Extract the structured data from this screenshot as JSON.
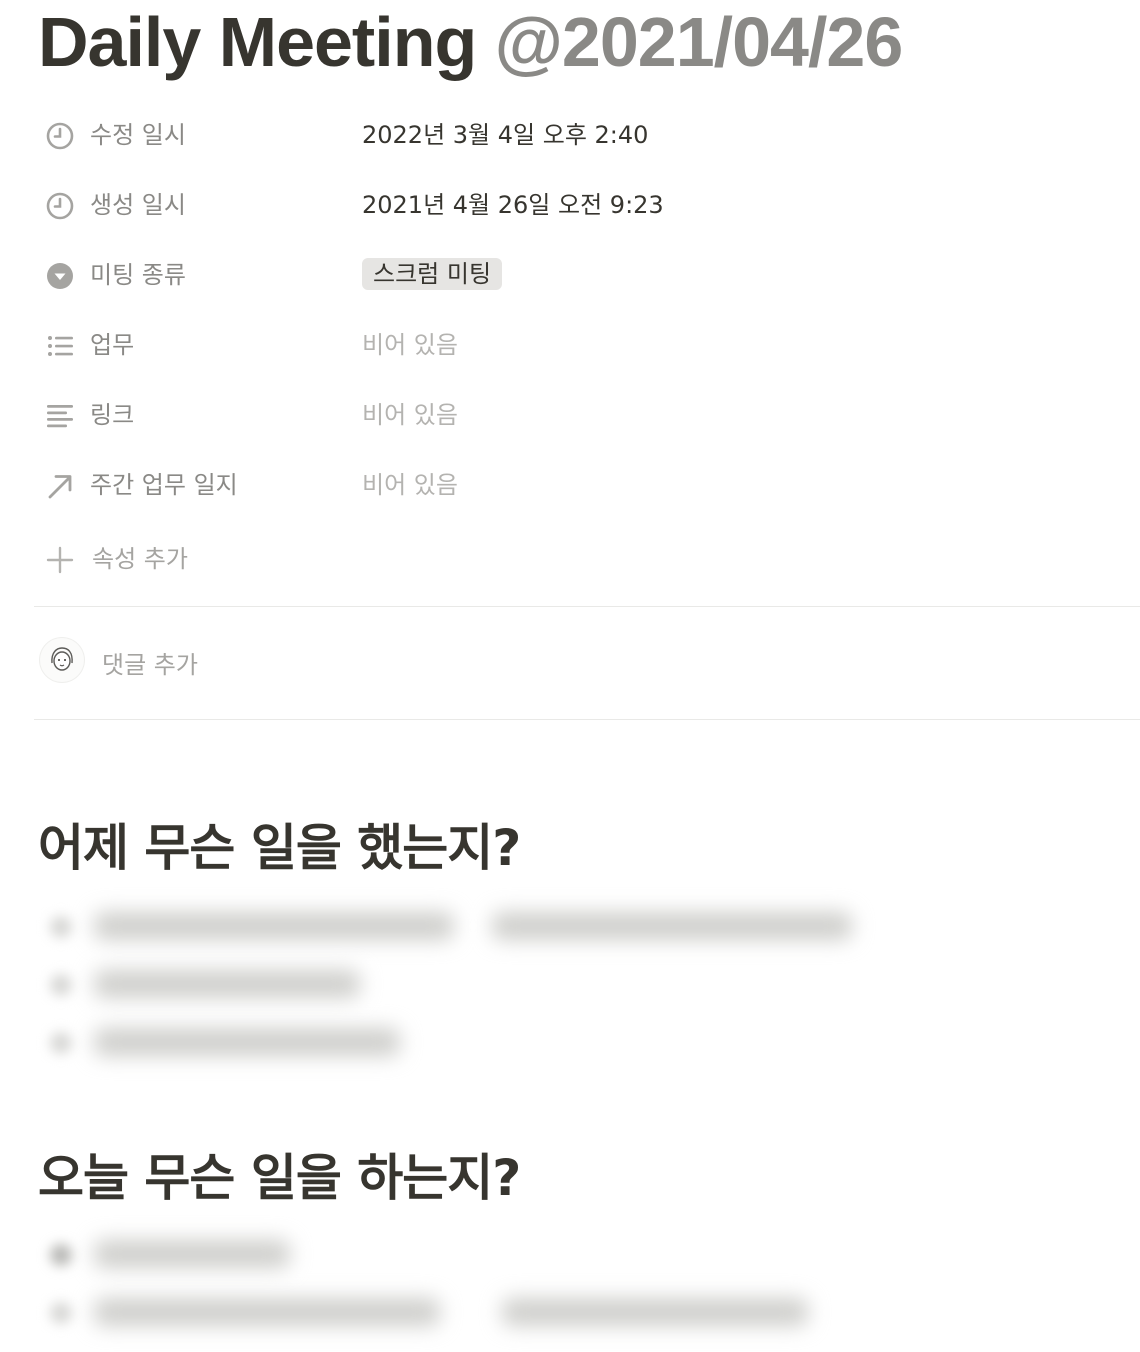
{
  "page": {
    "title": "Daily Meeting",
    "title_mention": "@2021/04/26"
  },
  "properties": [
    {
      "icon": "clock-icon",
      "label": "수정 일시",
      "value": "2022년 3월 4일 오후 2:40"
    },
    {
      "icon": "clock-icon",
      "label": "생성 일시",
      "value": "2021년 4월 26일 오전 9:23"
    },
    {
      "icon": "select-icon",
      "label": "미팅 종류",
      "value": "스크럼 미팅"
    },
    {
      "icon": "list-icon",
      "label": "업무",
      "value": "비어 있음"
    },
    {
      "icon": "text-icon",
      "label": "링크",
      "value": "비어 있음"
    },
    {
      "icon": "relation-arrow-icon",
      "label": "주간 업무 일지",
      "value": "비어 있음"
    }
  ],
  "add_property_label": "속성 추가",
  "comment": {
    "placeholder": "댓글 추가"
  },
  "sections": [
    {
      "heading": "어제 무슨 일을 했는지?"
    },
    {
      "heading": "오늘 무슨 일을 하는지?"
    }
  ],
  "colors": {
    "text": "#37352f",
    "muted": "#8a8986",
    "placeholder": "#b4b3b0",
    "tag_bg": "#e6e5e3",
    "divider": "#e9e9e7"
  }
}
